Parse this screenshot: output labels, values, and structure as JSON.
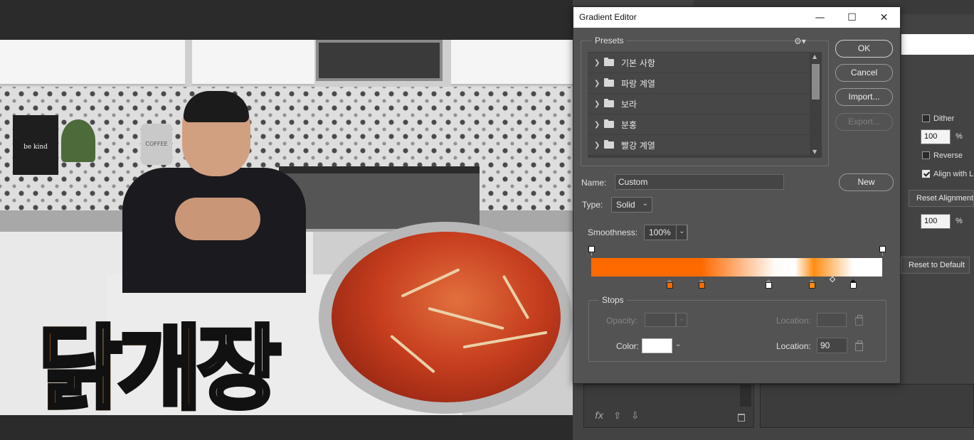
{
  "dialog": {
    "title": "Gradient Editor",
    "window_controls": {
      "minimize": "—",
      "maximize": "☐",
      "close": "✕"
    },
    "presets": {
      "label": "Presets",
      "items": [
        {
          "label": "기본 사항"
        },
        {
          "label": "파랑 계열"
        },
        {
          "label": "보라"
        },
        {
          "label": "분홍"
        },
        {
          "label": "빨강 계열"
        }
      ]
    },
    "buttons": {
      "ok": "OK",
      "cancel": "Cancel",
      "import": "Import...",
      "export": "Export...",
      "new": "New"
    },
    "name": {
      "label": "Name:",
      "value": "Custom"
    },
    "type": {
      "label": "Type:",
      "value": "Solid"
    },
    "smoothness": {
      "label": "Smoothness:",
      "value": "100%"
    },
    "gradient": {
      "color_stops": [
        {
          "color": "#ff6a00",
          "location": 27
        },
        {
          "color": "#ff6a00",
          "location": 38
        },
        {
          "color": "#ffffff",
          "location": 61
        },
        {
          "color": "#ff8c10",
          "location": 76
        },
        {
          "color": "#ffffff",
          "location": 90,
          "selected": true
        }
      ],
      "opacity_stops": [
        {
          "location": 0
        },
        {
          "location": 100
        }
      ],
      "midpoint_location": 83
    },
    "stops": {
      "label": "Stops",
      "opacity_label": "Opacity:",
      "opacity_location_label": "Location:",
      "color_label": "Color:",
      "color_value": "#ffffff",
      "color_location_label": "Location:",
      "color_location_value": "90"
    }
  },
  "right_panel": {
    "dither": "Dither",
    "opacity_value": "100",
    "percent": "%",
    "reverse": "Reverse",
    "align_with_layer": "Align with L",
    "reset_alignment": "Reset Alignment",
    "scale_value": "100",
    "reset_to_default": "Reset to Default"
  },
  "layers_panel": {
    "fx": "fx"
  },
  "canvas": {
    "title_text": [
      "닭",
      "개",
      "장"
    ],
    "sign_text": "be kind",
    "canister_text": "COFFEE"
  }
}
